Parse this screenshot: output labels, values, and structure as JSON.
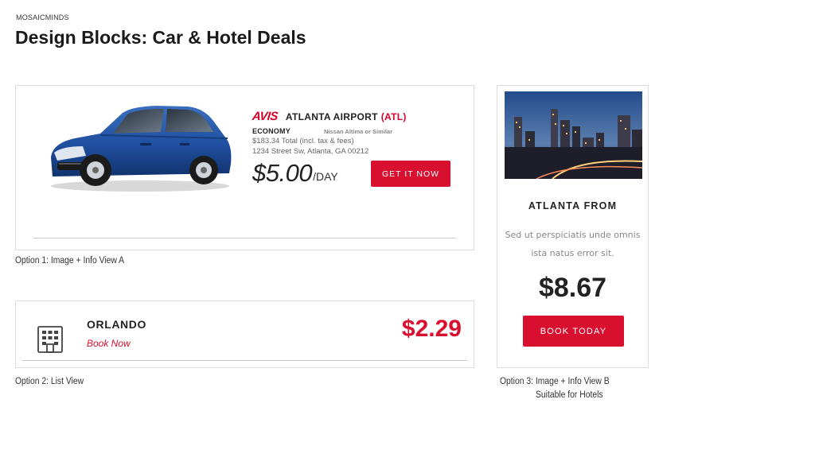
{
  "header": {
    "brand": "MOSAICMINDS",
    "title_bold": "Design Blocks:",
    "title_rest": " Car & Hotel Deals"
  },
  "option1": {
    "vendor_logo": "AVIS",
    "location": "ATLANTA AIRPORT",
    "location_code": "(ATL)",
    "car_class": "ECONOMY",
    "car_model": "Nissan Altima or Similar",
    "total": "$183.34 Total (incl. tax & fees)",
    "address": "1234 Street Sw, Atlanta, GA 00212",
    "price": "$5.00",
    "price_unit": "/DAY",
    "cta_label": "GET IT NOW",
    "caption": "Option 1: Image + Info View A",
    "image_icon": "blue-sedan-car"
  },
  "option2": {
    "icon": "hotel-building-icon",
    "city": "ORLANDO",
    "link_label": "Book Now",
    "price": "$2.29",
    "caption": "Option 2: List View"
  },
  "option3": {
    "image_icon": "city-skyline-night",
    "title": "ATLANTA FROM",
    "description": "Sed ut perspiciatis unde omnis ista natus error sit.",
    "price": "$8.67",
    "cta_label": "BOOK TODAY",
    "caption_line1": "Option 3: Image + Info View B",
    "caption_line2": "Suitable for Hotels"
  },
  "colors": {
    "accent_red": "#d90f2f",
    "avis_red": "#d4002a",
    "border": "#dcdcdc",
    "text_dark": "#222222",
    "text_muted": "#888888"
  }
}
